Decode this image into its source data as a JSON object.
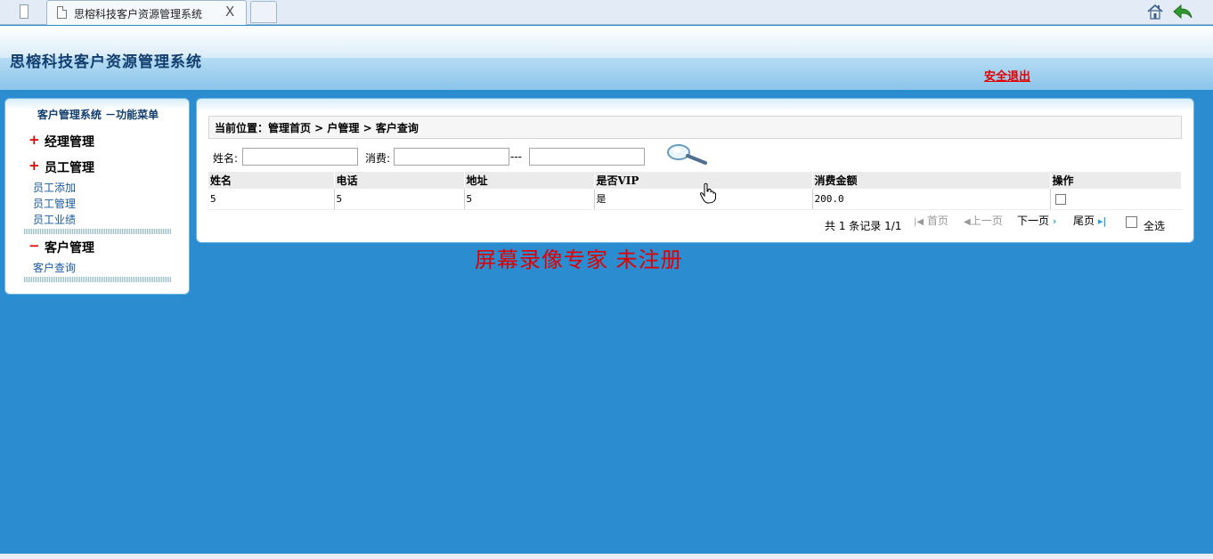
{
  "browser": {
    "tab_title": "思榕科技客户资源管理系统",
    "tab_close": "X"
  },
  "header": {
    "title": "思榕科技客户资源管理系统",
    "logout": "安全退出"
  },
  "menu": {
    "title": "客户管理系统 －功能菜单",
    "groups": [
      {
        "sign": "+",
        "label": "经理管理",
        "items": []
      },
      {
        "sign": "+",
        "label": "员工管理",
        "items": [
          "员工添加",
          "员工管理",
          "员工业绩"
        ]
      },
      {
        "sign": "−",
        "label": "客户管理",
        "items": [
          "客户查询"
        ]
      }
    ]
  },
  "breadcrumb": "当前位置：管理首页 > 户管理 > 客户查询",
  "search": {
    "name_label": "姓名:",
    "name_value": "",
    "consume_label": "消费:",
    "consume_min": "",
    "range_sep": "---",
    "consume_max": ""
  },
  "table": {
    "columns": [
      "姓名",
      "电话",
      "地址",
      "是否VIP",
      "消费金额",
      "操作"
    ],
    "rows": [
      {
        "name": "5",
        "phone": "5",
        "address": "5",
        "vip": "是",
        "amount": "200.0"
      }
    ]
  },
  "pagination": {
    "summary": "共 1 条记录 1/1",
    "first": "首页",
    "prev": "上一页",
    "next": "下一页",
    "last": "尾页",
    "select_all": "全选"
  },
  "watermark": "屏幕录像专家 未注册",
  "colors": {
    "background": "#2b8cd0",
    "title": "#123f6e",
    "accent_red": "#e00000",
    "link": "#1a5aa0"
  }
}
